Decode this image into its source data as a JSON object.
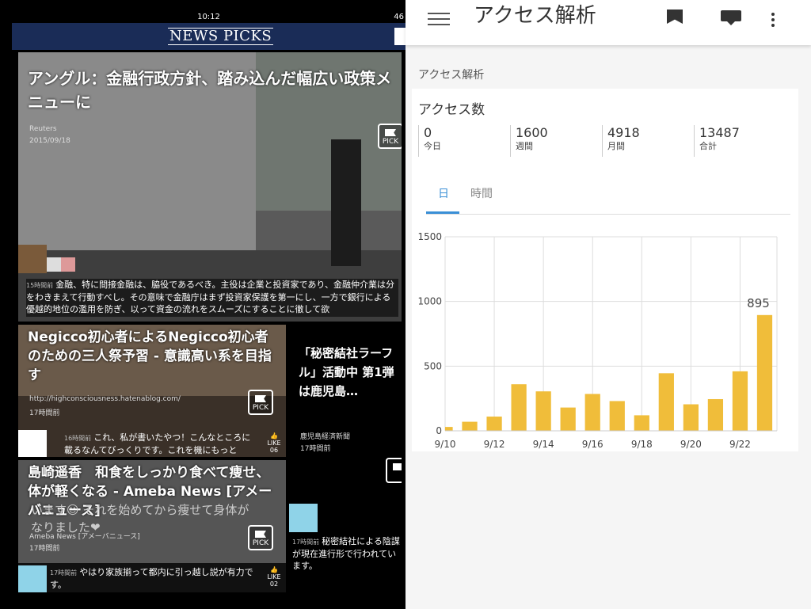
{
  "statusbar": {
    "time": "10:12",
    "battery": "46"
  },
  "header": {
    "logo": "NEWS PICKS"
  },
  "cards": {
    "c1": {
      "title": "アングル：金融行政方針、踏み込んだ幅広い政策メニューに",
      "source": "Reuters",
      "date": "2015/09/18",
      "pick": "PICK",
      "comment_time": "15時間前",
      "comment": "金融、特に間接金融は、脇役であるべき。主役は企業と投資家であり、金融仲介業は分をわきまえて行動すべし。その意味で金融庁はまず投資家保護を第一にし、一方で銀行による優越的地位の濫用を防ぎ、以って資金の流れをスムーズにすることに徹して欲"
    },
    "c2": {
      "title": "Negicco初心者によるNegicco初心者のための三人祭予習 - 意識高い系を目指す",
      "source": "http://highconsciousness.hatenablog.com/",
      "date": "17時間前",
      "pick": "PICK",
      "comment_time": "16時間前",
      "comment": "これ、私が書いたやつ！こんなところに載るなんてびっくりです。これを機にもっと",
      "like": "LIKE",
      "like_count": "06"
    },
    "c3": {
      "title": "「秘密結社ラーフル」活動中 第1弾は鹿児島…",
      "source": "鹿児島経済新聞",
      "date": "17時間前",
      "comment_time": "17時間前",
      "comment": "秘密結社による陰謀が現在進行形で行われています。"
    },
    "c4": {
      "title": "島崎遥香　和食をしっかり食べて痩せ、体が軽くなる - Ameba News [アメーバニュース]",
      "source": "Ameba News [アメーバニュース]",
      "date": "17時間前",
      "pick": "PICK",
      "overlay": "います☺ それを始めてから痩せて身体が なりました❤",
      "comment_time": "17時間前",
      "comment": "やはり家族揃って都内に引っ越し説が有力です。",
      "like": "LIKE",
      "like_count": "02"
    }
  },
  "analytics": {
    "app_title": "アクセス解析",
    "section_label": "アクセス解析",
    "stats_title": "アクセス数",
    "stats": [
      {
        "value": "0",
        "label": "今日"
      },
      {
        "value": "1600",
        "label": "週間"
      },
      {
        "value": "4918",
        "label": "月間"
      },
      {
        "value": "13487",
        "label": "合計"
      }
    ],
    "tabs": [
      {
        "label": "日",
        "active": true
      },
      {
        "label": "時間",
        "active": false
      }
    ],
    "colors": {
      "bar": "#f0bd3a",
      "accent": "#3a8fd6"
    }
  },
  "chart_data": {
    "type": "bar",
    "categories": [
      "9/10",
      "9/11",
      "9/12",
      "9/13",
      "9/14",
      "9/15",
      "9/16",
      "9/17",
      "9/18",
      "9/19",
      "9/20",
      "9/21",
      "9/22",
      "9/23"
    ],
    "x_tick_labels": [
      "9/10",
      "9/12",
      "9/14",
      "9/16",
      "9/18",
      "9/20",
      "9/22"
    ],
    "values": [
      30,
      70,
      110,
      360,
      305,
      180,
      285,
      230,
      120,
      445,
      205,
      245,
      460,
      895
    ],
    "ylim": [
      0,
      1500
    ],
    "yticks": [
      "0",
      "500",
      "1000",
      "1500"
    ],
    "data_label": "895",
    "grid": true
  }
}
